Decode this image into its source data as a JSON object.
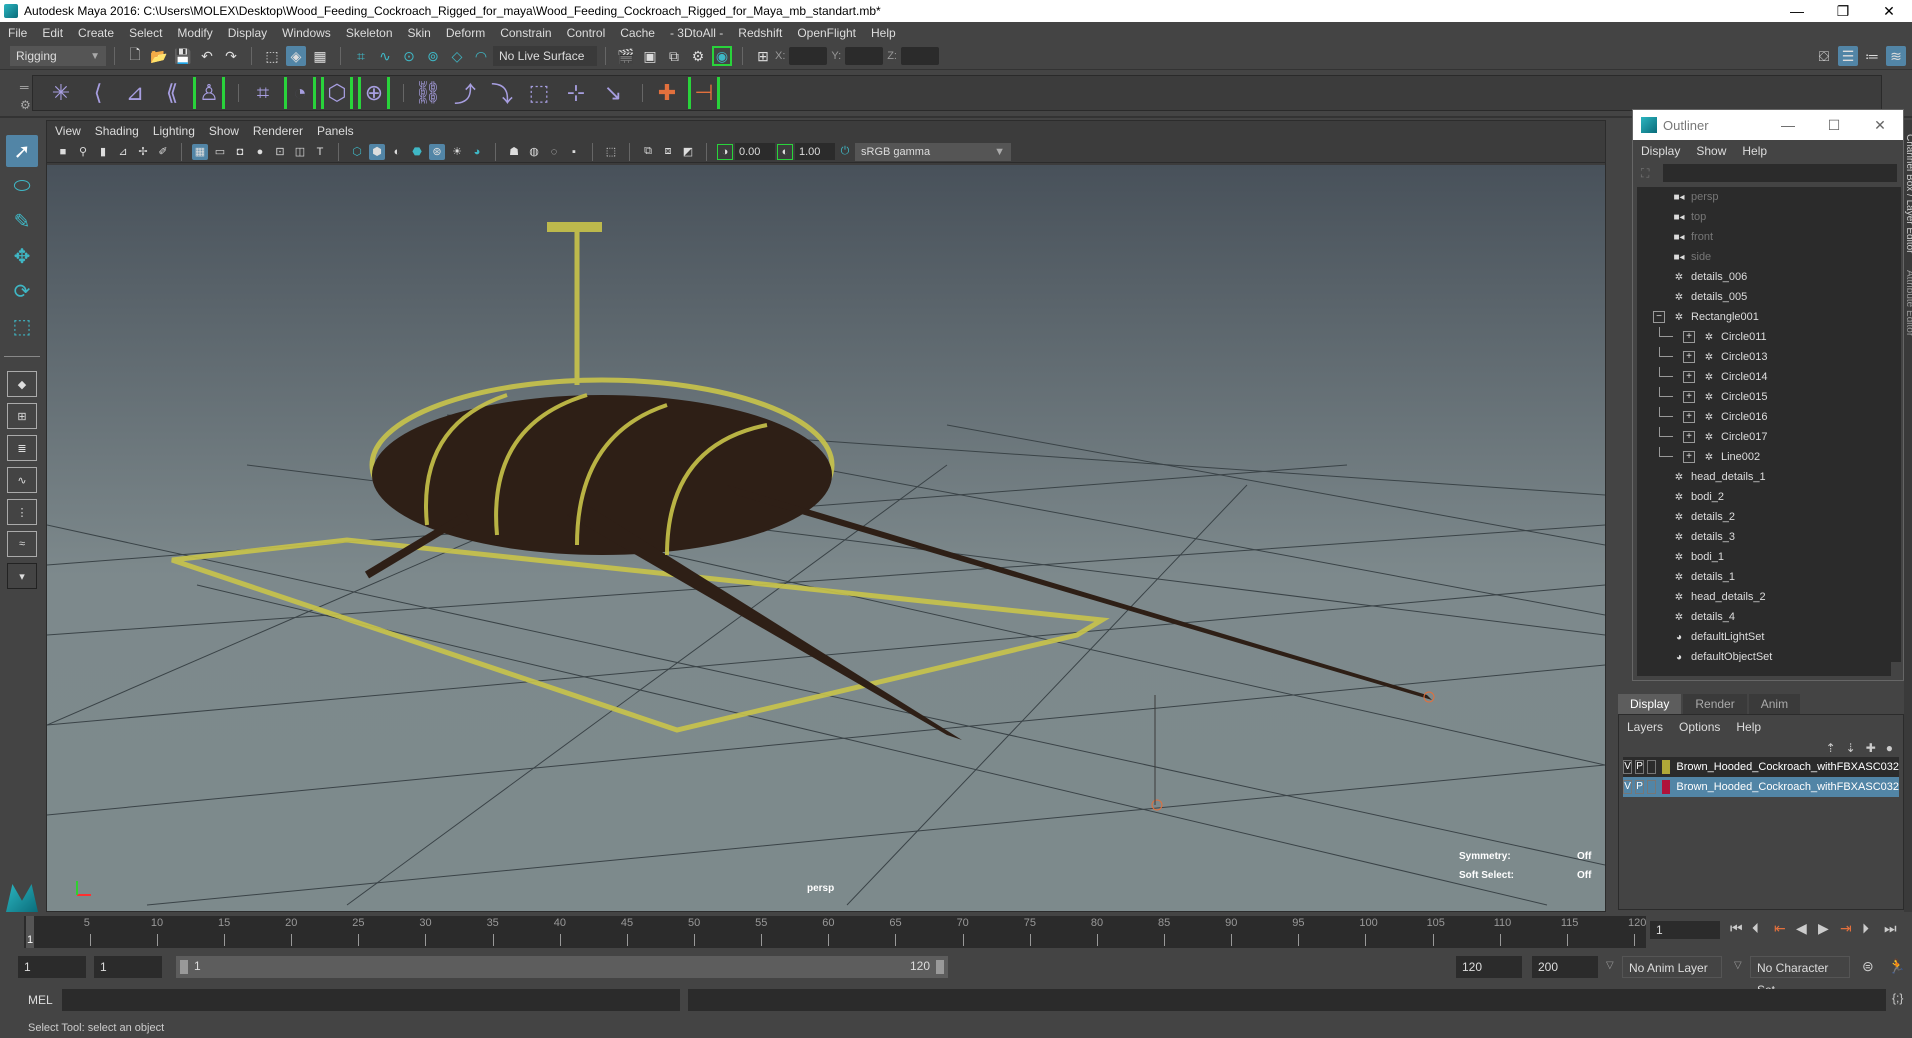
{
  "window": {
    "title": "Autodesk Maya 2016: C:\\Users\\MOLEX\\Desktop\\Wood_Feeding_Cockroach_Rigged_for_maya\\Wood_Feeding_Cockroach_Rigged_for_Maya_mb_standart.mb*",
    "minimize": "—",
    "restore": "❐",
    "close": "✕"
  },
  "menubar": [
    "File",
    "Edit",
    "Create",
    "Select",
    "Modify",
    "Display",
    "Windows",
    "Skeleton",
    "Skin",
    "Deform",
    "Constrain",
    "Control",
    "Cache",
    "- 3DtoAll -",
    "Redshift",
    "OpenFlight",
    "Help"
  ],
  "status_line": {
    "mode": "Rigging",
    "live_surface": "No Live Surface",
    "x_label": "X:",
    "y_label": "Y:",
    "z_label": "Z:"
  },
  "shelf": {
    "icons": [
      "joint-tool",
      "ik-handle",
      "ik-spline",
      "insert-joint",
      "hik-character",
      "skin-bind",
      "smooth-bind",
      "lattice",
      "cluster",
      "parent-constraint",
      "point-constraint",
      "orient-constraint",
      "scale-constraint",
      "aim-constraint",
      "pole-vector",
      "plus-marker",
      "bracket-marker"
    ]
  },
  "viewport": {
    "menu": [
      "View",
      "Shading",
      "Lighting",
      "Show",
      "Renderer",
      "Panels"
    ],
    "exposure": "0.00",
    "gamma": "1.00",
    "colorspace": "sRGB gamma",
    "camera_label": "persp",
    "symmetry_label": "Symmetry:",
    "symmetry_value": "Off",
    "soft_select_label": "Soft Select:",
    "soft_select_value": "Off"
  },
  "outliner": {
    "title": "Outliner",
    "menu": [
      "Display",
      "Show",
      "Help"
    ],
    "items": [
      {
        "label": "persp",
        "type": "camera",
        "depth": 0
      },
      {
        "label": "top",
        "type": "camera",
        "depth": 0
      },
      {
        "label": "front",
        "type": "camera",
        "depth": 0
      },
      {
        "label": "side",
        "type": "camera",
        "depth": 0
      },
      {
        "label": "details_006",
        "type": "mesh",
        "depth": 0
      },
      {
        "label": "details_005",
        "type": "mesh",
        "depth": 0
      },
      {
        "label": "Rectangle001",
        "type": "mesh",
        "depth": 0,
        "expander": "−"
      },
      {
        "label": "Circle011",
        "type": "mesh",
        "depth": 1,
        "expander": "+"
      },
      {
        "label": "Circle013",
        "type": "mesh",
        "depth": 1,
        "expander": "+"
      },
      {
        "label": "Circle014",
        "type": "mesh",
        "depth": 1,
        "expander": "+"
      },
      {
        "label": "Circle015",
        "type": "mesh",
        "depth": 1,
        "expander": "+"
      },
      {
        "label": "Circle016",
        "type": "mesh",
        "depth": 1,
        "expander": "+"
      },
      {
        "label": "Circle017",
        "type": "mesh",
        "depth": 1,
        "expander": "+"
      },
      {
        "label": "Line002",
        "type": "mesh",
        "depth": 1,
        "expander": "+"
      },
      {
        "label": "head_details_1",
        "type": "mesh",
        "depth": 0
      },
      {
        "label": "bodi_2",
        "type": "mesh",
        "depth": 0
      },
      {
        "label": "details_2",
        "type": "mesh",
        "depth": 0
      },
      {
        "label": "details_3",
        "type": "mesh",
        "depth": 0
      },
      {
        "label": "bodi_1",
        "type": "mesh",
        "depth": 0
      },
      {
        "label": "details_1",
        "type": "mesh",
        "depth": 0
      },
      {
        "label": "head_details_2",
        "type": "mesh",
        "depth": 0
      },
      {
        "label": "details_4",
        "type": "mesh",
        "depth": 0
      },
      {
        "label": "defaultLightSet",
        "type": "set",
        "depth": 0
      },
      {
        "label": "defaultObjectSet",
        "type": "set",
        "depth": 0
      }
    ]
  },
  "side_tabs": [
    "Channel Box / Layer Editor",
    "Attribute Editor"
  ],
  "layer_editor": {
    "tabs": [
      "Display",
      "Render",
      "Anim"
    ],
    "active_tab": "Display",
    "menu": [
      "Layers",
      "Options",
      "Help"
    ],
    "layers": [
      {
        "v": "V",
        "p": "P",
        "color": "#b0a838",
        "name": "Brown_Hooded_Cockroach_withFBXASC032",
        "selected": false
      },
      {
        "v": "V",
        "p": "P",
        "color": "#b0123a",
        "name": "Brown_Hooded_Cockroach_withFBXASC032",
        "selected": true
      }
    ]
  },
  "timeline": {
    "ticks": [
      5,
      10,
      15,
      20,
      25,
      30,
      35,
      40,
      45,
      50,
      55,
      60,
      65,
      70,
      75,
      80,
      85,
      90,
      95,
      100,
      105,
      110,
      115,
      120
    ],
    "current_frame": "1",
    "start_marker": "1"
  },
  "range": {
    "start": "1",
    "playback_start": "1",
    "slider_start": "1",
    "slider_end": "120",
    "playback_end": "120",
    "end": "200",
    "anim_layer": "No Anim Layer",
    "character_set": "No Character Set"
  },
  "command": {
    "label": "MEL"
  },
  "status": {
    "help_line": "Select Tool: select an object"
  }
}
